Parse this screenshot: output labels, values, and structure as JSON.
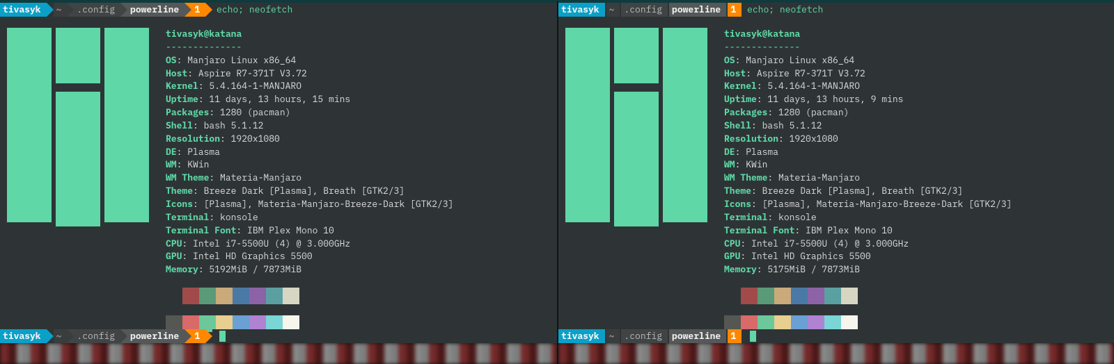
{
  "common": {
    "user_seg": "tivasyk",
    "home_seg": "~",
    "cfg_seg": ".config",
    "pl_seg": "powerline",
    "num_seg": "1",
    "command": "echo; neofetch",
    "dashes": "--------------",
    "title_user": "tivasyk",
    "title_at": "@",
    "title_host": "katana",
    "labels": {
      "os": "OS",
      "host": "Host",
      "kernel": "Kernel",
      "uptime": "Uptime",
      "packages": "Packages",
      "shell": "Shell",
      "resolution": "Resolution",
      "de": "DE",
      "wm": "WM",
      "wmtheme": "WM Theme",
      "theme": "Theme",
      "icons": "Icons",
      "terminal": "Terminal",
      "font": "Terminal Font",
      "cpu": "CPU",
      "gpu": "GPU",
      "memory": "Memory"
    },
    "palette_row1": [
      "#2e3436",
      "#a14a4a",
      "#5a9a78",
      "#caa97a",
      "#4a79a6",
      "#8b63a6",
      "#5ba0a1",
      "#d6d6c2"
    ],
    "palette_row2": [
      "#555753",
      "#d86a6a",
      "#6cc89a",
      "#e8cf90",
      "#6aa0d4",
      "#b083d2",
      "#7ad6d6",
      "#f6f6ec"
    ]
  },
  "left": {
    "os": "Manjaro Linux x86_64",
    "host": "Aspire R7-371T V3.72",
    "kernel": "5.4.164-1-MANJARO",
    "uptime": "11 days, 13 hours, 15 mins",
    "packages": "1280 (pacman)",
    "shell": "bash 5.1.12",
    "resolution": "1920x1080",
    "de": "Plasma",
    "wm": "KWin",
    "wmtheme": "Materia-Manjaro",
    "theme": "Breeze Dark [Plasma], Breath [GTK2/3]",
    "icons": "[Plasma], Materia-Manjaro-Breeze-Dark [GTK2/3]",
    "terminal": "konsole",
    "font": "IBM Plex Mono 10",
    "cpu": "Intel i7-5500U (4) @ 3.000GHz",
    "gpu": "Intel HD Graphics 5500",
    "memory": "5192MiB / 7873MiB"
  },
  "right": {
    "os": "Manjaro Linux x86_64",
    "host": "Aspire R7-371T V3.72",
    "kernel": "5.4.164-1-MANJARO",
    "uptime": "11 days, 13 hours, 9 mins",
    "packages": "1280 (pacman)",
    "shell": "bash 5.1.12",
    "resolution": "1920x1080",
    "de": "Plasma",
    "wm": "KWin",
    "wmtheme": "Materia-Manjaro",
    "theme": "Breeze Dark [Plasma], Breath [GTK2/3]",
    "icons": "[Plasma], Materia-Manjaro-Breeze-Dark [GTK2/3]",
    "terminal": "konsole",
    "font": "IBM Plex Mono 10",
    "cpu": "Intel i7-5500U (4) @ 3.000GHz",
    "gpu": "Intel HD Graphics 5500",
    "memory": "5175MiB / 7873MiB"
  }
}
